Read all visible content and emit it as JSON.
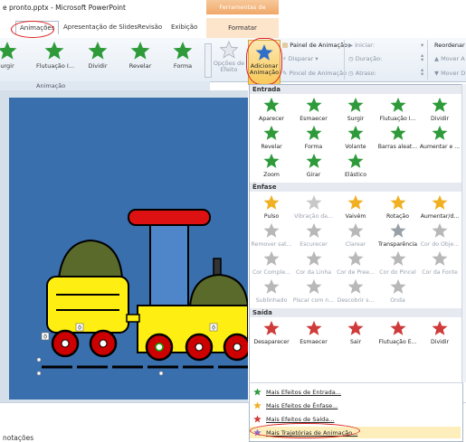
{
  "app": {
    "title": "e pronto.pptx - Microsoft PowerPoint",
    "context_tools": "Ferramentas de Desenho"
  },
  "tabs": [
    "Animações",
    "Apresentação de Slides",
    "Revisão",
    "Exibição",
    "Formatar"
  ],
  "ribbon": {
    "effects": [
      "urgir",
      "Flutuação I...",
      "Dividir",
      "Revelar",
      "Forma"
    ],
    "effect_options": "Opções de Efeito",
    "group_label": "Animação",
    "add_animation": "Adicionar Animação",
    "animation_pane": "Painel de Animação",
    "trigger": "Disparar",
    "animation_painter": "Pincel de Animação",
    "start": "Iniciar:",
    "duration": "Duração:",
    "delay": "Atraso:",
    "reorder": "Reordenar A",
    "move_earlier": "Mover A",
    "move_later": "Mover D"
  },
  "gallery": {
    "sections": [
      {
        "title": "Entrada",
        "items": [
          {
            "label": "Aparecer",
            "color": "#2e9a3a",
            "dim": false
          },
          {
            "label": "Esmaecer",
            "color": "#2e9a3a",
            "dim": false
          },
          {
            "label": "Surgir",
            "color": "#2e9a3a",
            "dim": false
          },
          {
            "label": "Flutuação I...",
            "color": "#2e9a3a",
            "dim": false
          },
          {
            "label": "Dividir",
            "color": "#2e9a3a",
            "dim": false
          },
          {
            "label": "Revelar",
            "color": "#2e9a3a",
            "dim": false
          },
          {
            "label": "Forma",
            "color": "#2e9a3a",
            "dim": false
          },
          {
            "label": "Volante",
            "color": "#2e9a3a",
            "dim": false
          },
          {
            "label": "Barras aleat...",
            "color": "#2e9a3a",
            "dim": false
          },
          {
            "label": "Aumentar e ...",
            "color": "#2e9a3a",
            "dim": false
          },
          {
            "label": "Zoom",
            "color": "#2e9a3a",
            "dim": false
          },
          {
            "label": "Girar",
            "color": "#2e9a3a",
            "dim": false
          },
          {
            "label": "Elástico",
            "color": "#2e9a3a",
            "dim": false
          }
        ]
      },
      {
        "title": "Ênfase",
        "items": [
          {
            "label": "Pulso",
            "color": "#f0b021",
            "dim": false
          },
          {
            "label": "Vibração da...",
            "color": "#c8c8c8",
            "dim": true
          },
          {
            "label": "Vaivém",
            "color": "#f0b021",
            "dim": false
          },
          {
            "label": "Rotação",
            "color": "#f0b021",
            "dim": false
          },
          {
            "label": "Aumentar/d...",
            "color": "#f0b021",
            "dim": false
          },
          {
            "label": "Remover sat...",
            "color": "#b8b8b8",
            "dim": true
          },
          {
            "label": "Escurecer",
            "color": "#b8b8b8",
            "dim": true
          },
          {
            "label": "Clarear",
            "color": "#b8b8b8",
            "dim": true
          },
          {
            "label": "Transparência",
            "color": "#9aa0a8",
            "dim": false
          },
          {
            "label": "Cor do Obje...",
            "color": "#b8b8b8",
            "dim": true
          },
          {
            "label": "Cor Comple...",
            "color": "#b8b8b8",
            "dim": true
          },
          {
            "label": "Cor da Linha",
            "color": "#b8b8b8",
            "dim": true
          },
          {
            "label": "Cor de Pree...",
            "color": "#b8b8b8",
            "dim": true
          },
          {
            "label": "Cor do Pincel",
            "color": "#b8b8b8",
            "dim": true
          },
          {
            "label": "Cor da Fonte",
            "color": "#b8b8b8",
            "dim": true
          },
          {
            "label": "Sublinhado",
            "color": "#b8b8b8",
            "dim": true
          },
          {
            "label": "Piscar com n...",
            "color": "#b8b8b8",
            "dim": true
          },
          {
            "label": "Descobrir s...",
            "color": "#b8b8b8",
            "dim": true
          },
          {
            "label": "Onda",
            "color": "#b8b8b8",
            "dim": true
          }
        ]
      },
      {
        "title": "Saída",
        "items": [
          {
            "label": "Desaparecer",
            "color": "#d03a3a",
            "dim": false
          },
          {
            "label": "Esmaecer",
            "color": "#d03a3a",
            "dim": false
          },
          {
            "label": "Sair",
            "color": "#d03a3a",
            "dim": false
          },
          {
            "label": "Flutuação E...",
            "color": "#d03a3a",
            "dim": false
          },
          {
            "label": "Dividir",
            "color": "#d03a3a",
            "dim": false
          }
        ]
      }
    ]
  },
  "menu": [
    {
      "label": "Mais Efeitos de Entrada...",
      "icon_color": "#2e9a3a"
    },
    {
      "label": "Mais Efeitos de Ênfase...",
      "icon_color": "#f0b021"
    },
    {
      "label": "Mais Efeitos de Saída...",
      "icon_color": "#d03a3a"
    },
    {
      "label": "Mais Trajetórias de Animação...",
      "icon_color": "#8a6bd0"
    }
  ],
  "status": {
    "notes": "notações"
  },
  "slide": {
    "labels": [
      "0",
      "0",
      "0"
    ]
  },
  "colors": {
    "accent": "#3a6fad",
    "highlight": "#d22"
  }
}
